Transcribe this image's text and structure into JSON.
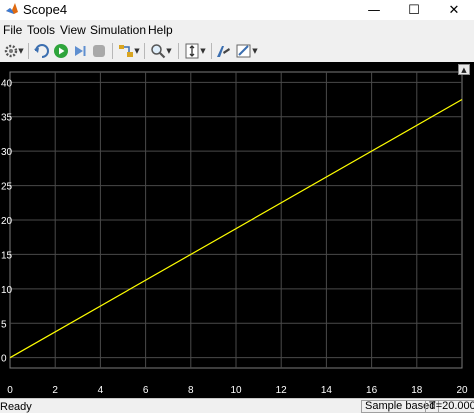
{
  "window": {
    "title": "Scope4",
    "minimize_glyph": "—",
    "maximize_glyph": "☐",
    "close_glyph": "✕"
  },
  "menu": [
    "File",
    "Tools",
    "View",
    "Simulation",
    "Help"
  ],
  "toolbar": {
    "icons": [
      "settings-icon",
      "restore-icon",
      "run-icon",
      "step-forward-icon",
      "stop-icon",
      "highlight-block-icon",
      "zoom-icon",
      "autoscale-icon",
      "cursor-measurements-icon",
      "style-icon"
    ]
  },
  "chart_data": {
    "type": "line",
    "x": [
      0,
      20
    ],
    "series": [
      {
        "values": [
          0,
          37.5
        ],
        "color": "#ffff00"
      }
    ],
    "xlim": [
      0,
      20
    ],
    "ylim": [
      -1.5,
      41.5
    ],
    "x_ticks": [
      "0",
      "2",
      "4",
      "6",
      "8",
      "10",
      "12",
      "14",
      "16",
      "18",
      "20"
    ],
    "y_ticks": [
      "0",
      "5",
      "10",
      "15",
      "20",
      "25",
      "30",
      "35",
      "40"
    ],
    "grid": true,
    "background": "#000000",
    "grid_color": "#4a4a4a"
  },
  "status": {
    "state": "Ready",
    "mode": "Sample based",
    "time": "T=20.000"
  }
}
